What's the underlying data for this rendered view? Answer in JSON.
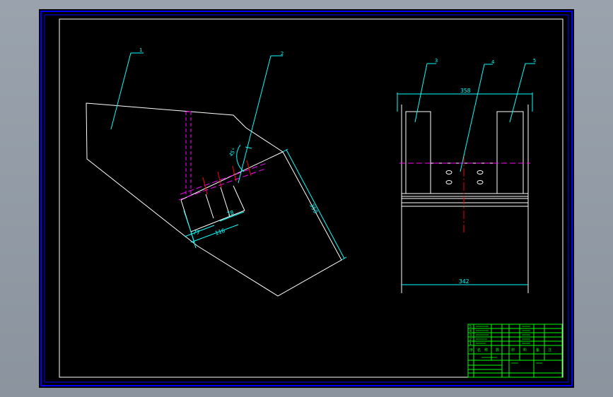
{
  "drawing": {
    "colors": {
      "background": "#000000",
      "outline": "#ffffff",
      "dimension": "#00ffff",
      "hidden": "#ff00ff",
      "center": "#ff0000",
      "sheet_frame": "#0000ff",
      "title_block": "#00ff00",
      "chrome": "#8b949e"
    },
    "part_balloons": [
      "1",
      "2",
      "3",
      "4",
      "5"
    ],
    "dimensions": {
      "left_view": {
        "length_a": "77",
        "length_b": "116",
        "length_c": "78",
        "length_d": "359",
        "angle": "45°"
      },
      "right_view": {
        "top_width": "358",
        "bottom_width": "342"
      }
    },
    "title_block": {
      "parts_list": [
        {
          "no": "5",
          "name": ""
        },
        {
          "no": "4",
          "name": ""
        },
        {
          "no": "3",
          "name": ""
        },
        {
          "no": "2",
          "name": ""
        },
        {
          "no": "1",
          "name": ""
        }
      ],
      "header": [
        "序",
        "名",
        "称",
        "数",
        "材",
        "料",
        "备",
        "注"
      ],
      "drawing_title": ""
    }
  }
}
